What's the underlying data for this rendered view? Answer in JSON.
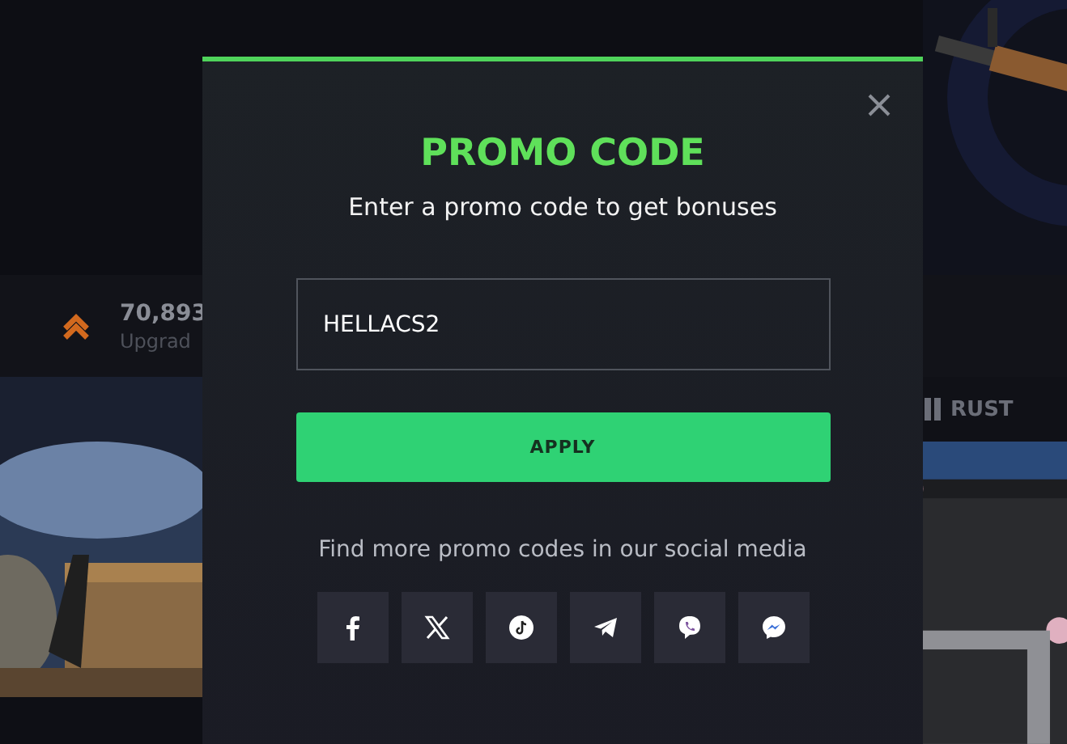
{
  "stats": [
    {
      "kind": "upgrade",
      "value": "70,893",
      "label": "Upgrad"
    }
  ],
  "game_tab": {
    "label": "RUST"
  },
  "modal": {
    "title": "PROMO CODE",
    "subtitle": "Enter a promo code to get bonuses",
    "input": {
      "value": "HELLACS2"
    },
    "button": "APPLY",
    "social_text": "Find more promo codes in our social media",
    "socials": [
      {
        "kind": "facebook"
      },
      {
        "kind": "x"
      },
      {
        "kind": "tiktok"
      },
      {
        "kind": "telegram"
      },
      {
        "kind": "viber"
      },
      {
        "kind": "messenger"
      }
    ]
  }
}
